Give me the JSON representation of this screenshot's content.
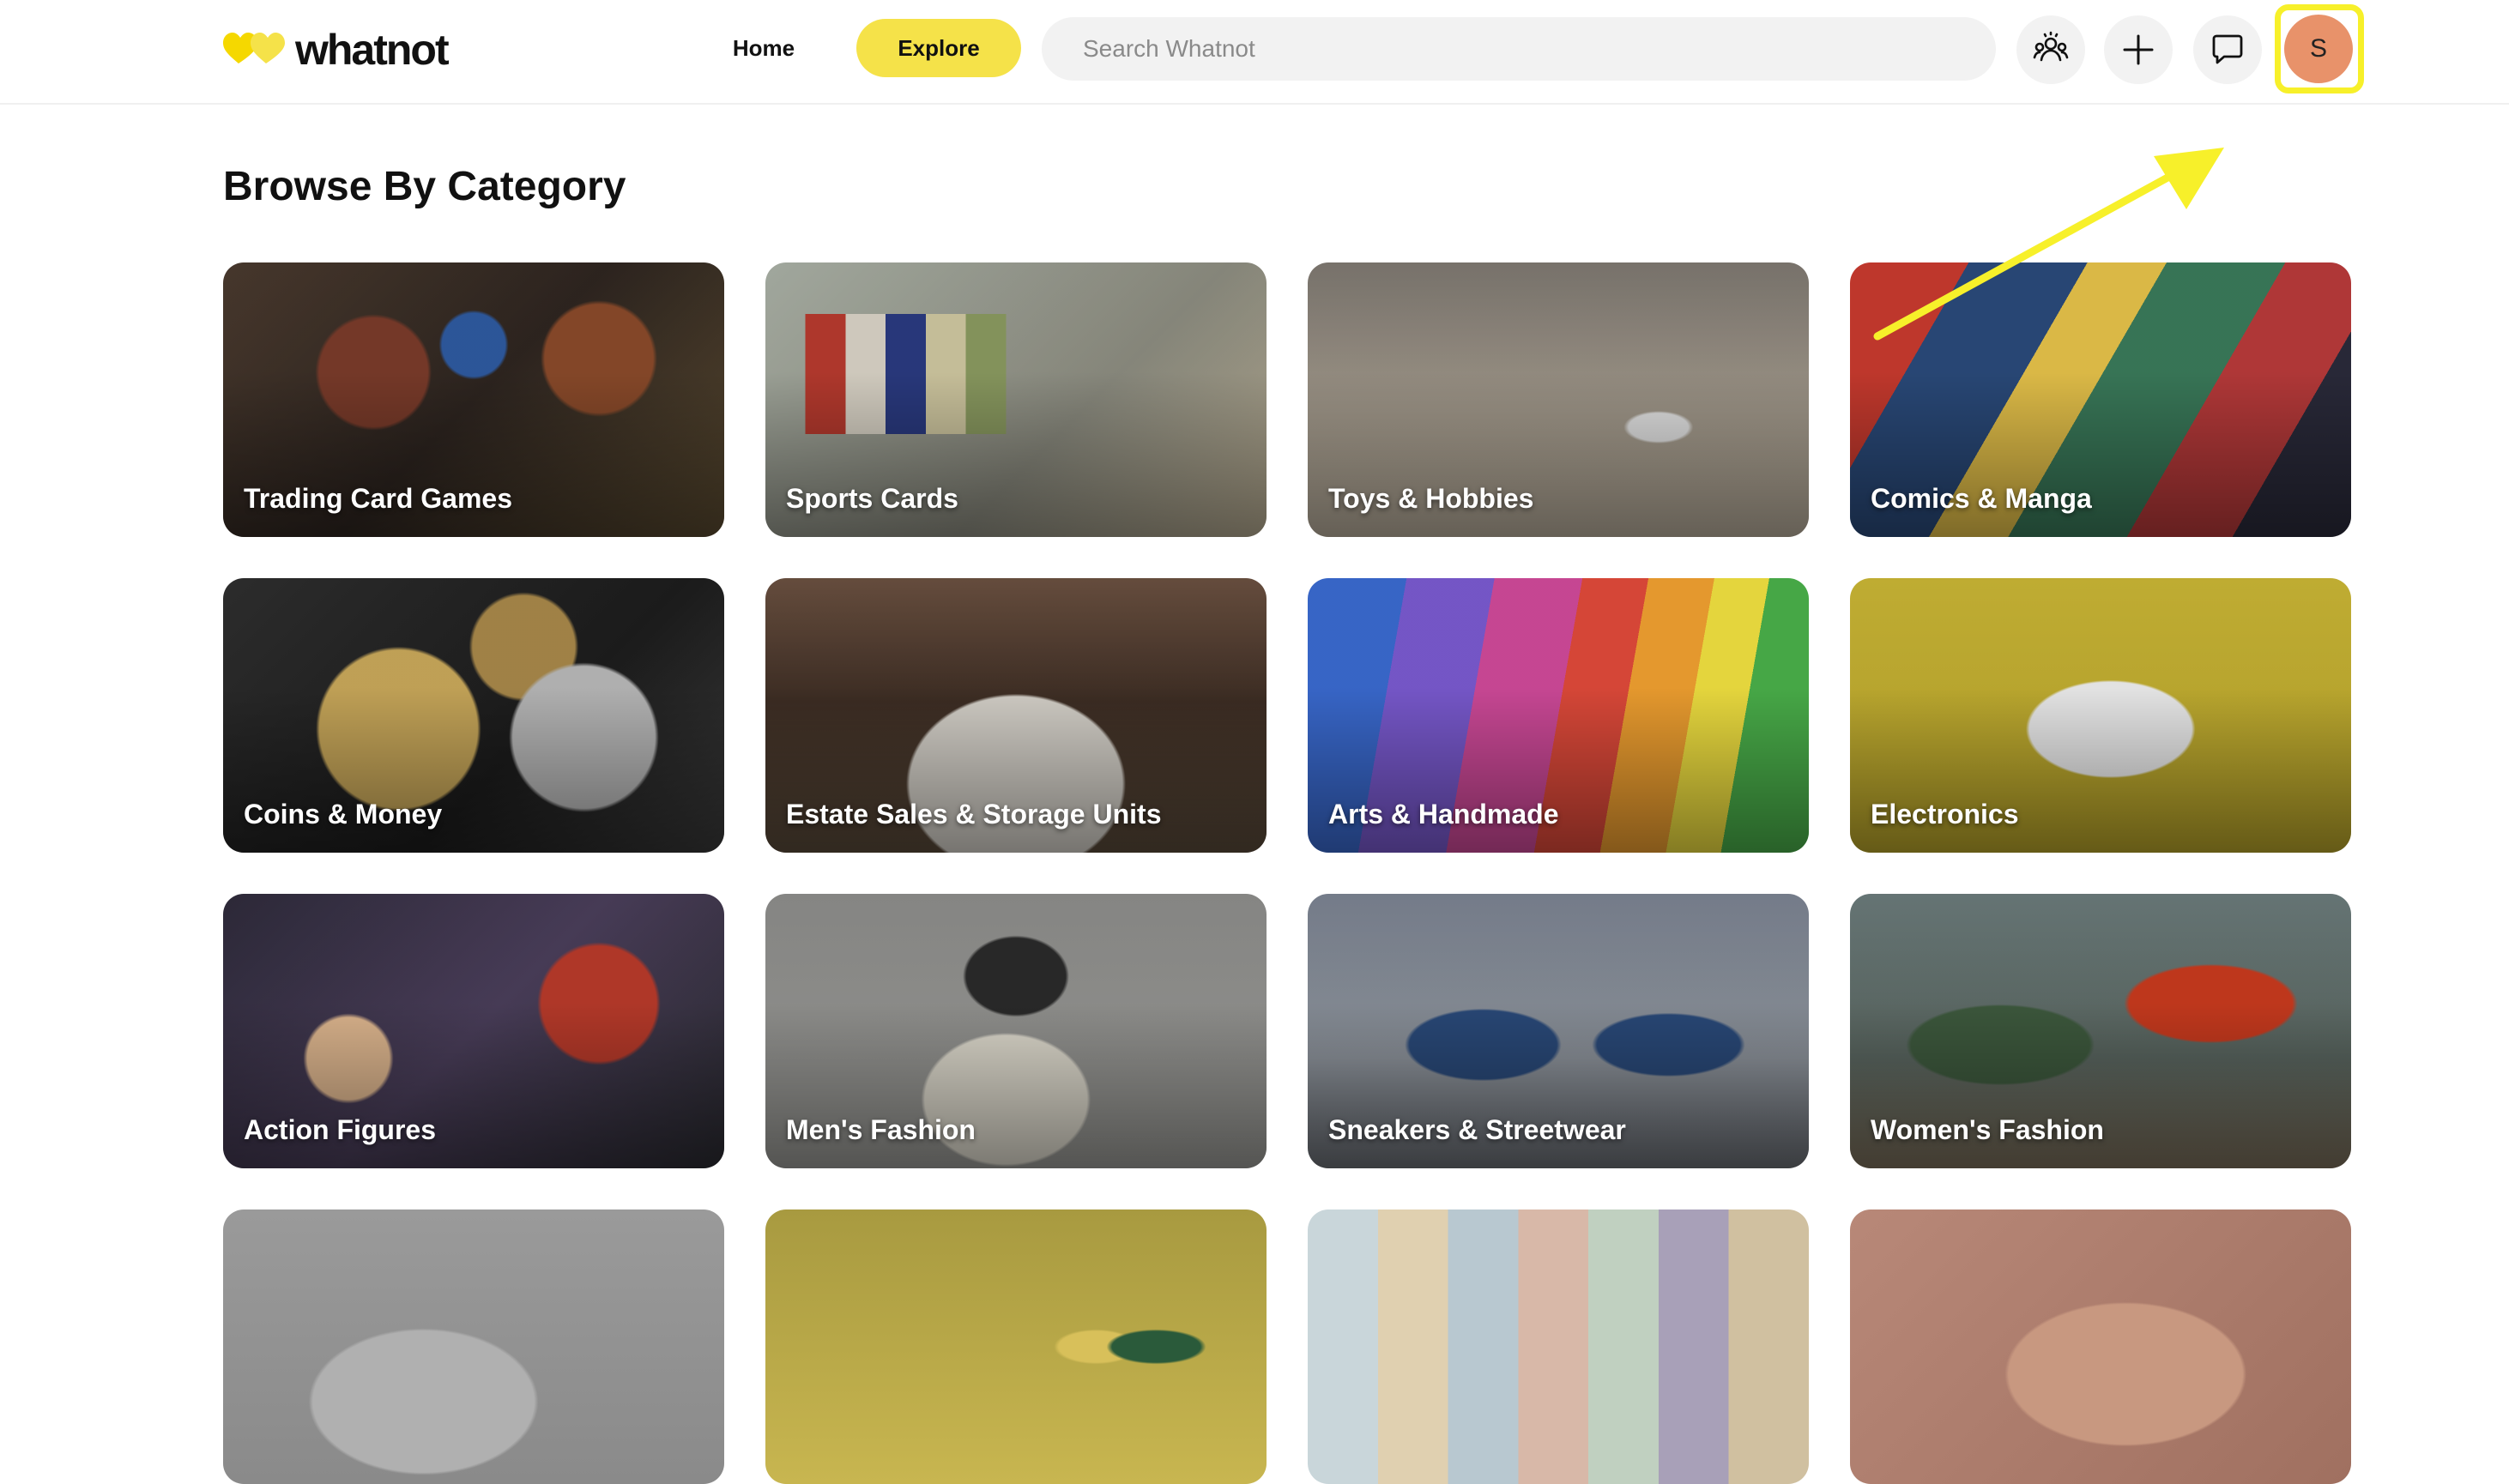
{
  "brand": {
    "name": "whatnot",
    "accent": "#f5e249",
    "logo_icon": "hearts-logo-icon"
  },
  "nav": {
    "home_label": "Home",
    "explore_label": "Explore"
  },
  "search": {
    "placeholder": "Search Whatnot",
    "value": ""
  },
  "header_icons": [
    {
      "name": "community-icon"
    },
    {
      "name": "plus-icon"
    },
    {
      "name": "chat-icon"
    }
  ],
  "user": {
    "avatar_initial": "S",
    "avatar_color": "#e8926a",
    "highlight_color": "#f7f02a"
  },
  "page": {
    "title": "Browse By Category"
  },
  "categories": [
    {
      "label": "Trading Card Games"
    },
    {
      "label": "Sports Cards"
    },
    {
      "label": "Toys & Hobbies"
    },
    {
      "label": "Comics & Manga"
    },
    {
      "label": "Coins & Money"
    },
    {
      "label": "Estate Sales & Storage Units"
    },
    {
      "label": "Arts & Handmade"
    },
    {
      "label": "Electronics"
    },
    {
      "label": "Action Figures"
    },
    {
      "label": "Men's Fashion"
    },
    {
      "label": "Sneakers & Streetwear"
    },
    {
      "label": "Women's Fashion"
    },
    {
      "label": ""
    },
    {
      "label": ""
    },
    {
      "label": ""
    },
    {
      "label": ""
    }
  ]
}
